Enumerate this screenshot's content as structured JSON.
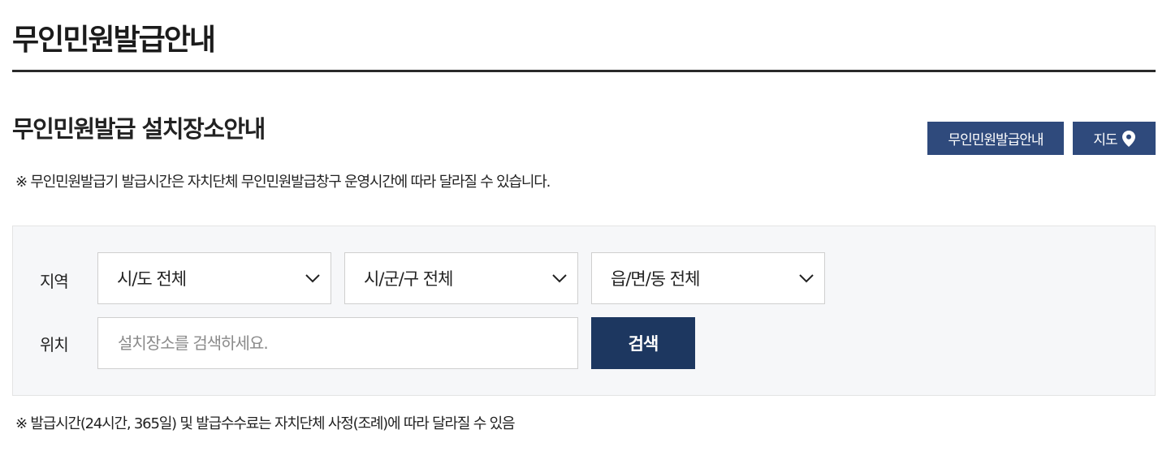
{
  "header": {
    "page_title": "무인민원발급안내"
  },
  "section": {
    "title": "무인민원발급 설치장소안내",
    "notice": "※ 무인민원발급기 발급시간은 자치단체 무인민원발급창구 운영시간에 따라 달라질 수 있습니다.",
    "guide_button": "무인민원발급안내",
    "map_button": "지도",
    "map_icon": "location-pin-icon"
  },
  "search": {
    "region_label": "지역",
    "location_label": "위치",
    "selects": [
      {
        "value": "시/도 전체"
      },
      {
        "value": "시/군/구 전체"
      },
      {
        "value": "읍/면/동 전체"
      }
    ],
    "input_placeholder": "설치장소를 검색하세요.",
    "input_value": "",
    "button_label": "검색"
  },
  "footer": {
    "notice": "※ 발급시간(24시간, 365일) 및 발급수수료는 자치단체 사정(조례)에 따라 달라질 수 있음"
  },
  "colors": {
    "nav_button": "#2f4a7c",
    "search_button": "#1d3760",
    "search_box_bg": "#f6f7f9"
  }
}
